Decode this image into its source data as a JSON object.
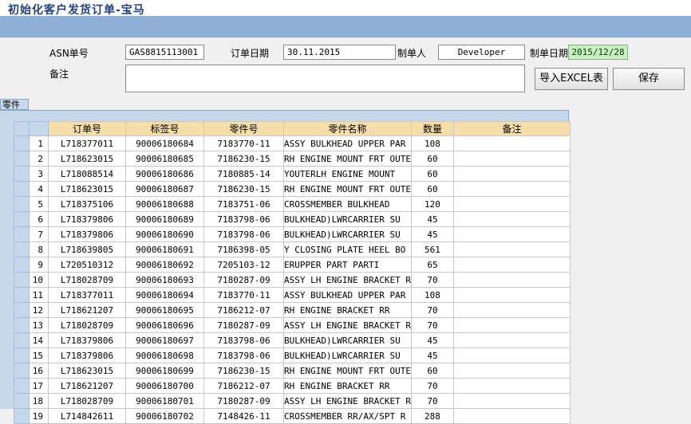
{
  "window": {
    "title": "初始化客户发货订单-宝马"
  },
  "form": {
    "asn_label": "ASN单号",
    "asn_value": "GAS8815113001",
    "order_date_label": "订单日期",
    "order_date_value": "30.11.2015",
    "creator_label": "制单人",
    "creator_value": "Developer",
    "create_date_label": "制单日期",
    "create_date_value": "2015/12/28",
    "remark_label": "备注",
    "remark_value": ""
  },
  "buttons": {
    "import_excel": "导入EXCEL表",
    "save": "保存"
  },
  "parts_tab": {
    "label": "零件"
  },
  "table": {
    "columns": [
      "订单号",
      "标签号",
      "零件号",
      "零件名称",
      "数量",
      "备注"
    ],
    "rows": [
      {
        "n": "1",
        "order": "L718377011",
        "tag": "90006180684",
        "part": "7183770-11",
        "name": "ASSY BULKHEAD UPPER PAR",
        "qty": "108",
        "remark": ""
      },
      {
        "n": "2",
        "order": "L718623015",
        "tag": "90006180685",
        "part": "7186230-15",
        "name": "RH ENGINE MOUNT FRT OUTE",
        "qty": "60",
        "remark": ""
      },
      {
        "n": "3",
        "order": "L718088514",
        "tag": "90006180686",
        "part": "7180885-14",
        "name": "YOUTERLH ENGINE MOUNT",
        "qty": "60",
        "remark": ""
      },
      {
        "n": "4",
        "order": "L718623015",
        "tag": "90006180687",
        "part": "7186230-15",
        "name": "RH ENGINE MOUNT FRT OUTE",
        "qty": "60",
        "remark": ""
      },
      {
        "n": "5",
        "order": "L718375106",
        "tag": "90006180688",
        "part": "7183751-06",
        "name": "CROSSMEMBER BULKHEAD",
        "qty": "120",
        "remark": ""
      },
      {
        "n": "6",
        "order": "L718379806",
        "tag": "90006180689",
        "part": "7183798-06",
        "name": "BULKHEAD)LWRCARRIER SU",
        "qty": "45",
        "remark": ""
      },
      {
        "n": "7",
        "order": "L718379806",
        "tag": "90006180690",
        "part": "7183798-06",
        "name": "BULKHEAD)LWRCARRIER SU",
        "qty": "45",
        "remark": ""
      },
      {
        "n": "8",
        "order": "L718639805",
        "tag": "90006180691",
        "part": "7186398-05",
        "name": "Y CLOSING PLATE HEEL BO",
        "qty": "561",
        "remark": ""
      },
      {
        "n": "9",
        "order": "L720510312",
        "tag": "90006180692",
        "part": "7205103-12",
        "name": "ERUPPER PART       PARTI",
        "qty": "65",
        "remark": ""
      },
      {
        "n": "10",
        "order": "L718028709",
        "tag": "90006180693",
        "part": "7180287-09",
        "name": "ASSY LH ENGINE BRACKET R",
        "qty": "70",
        "remark": ""
      },
      {
        "n": "11",
        "order": "L718377011",
        "tag": "90006180694",
        "part": "7183770-11",
        "name": "ASSY BULKHEAD UPPER PAR",
        "qty": "108",
        "remark": ""
      },
      {
        "n": "12",
        "order": "L718621207",
        "tag": "90006180695",
        "part": "7186212-07",
        "name": "RH ENGINE BRACKET RR",
        "qty": "70",
        "remark": ""
      },
      {
        "n": "13",
        "order": "L718028709",
        "tag": "90006180696",
        "part": "7180287-09",
        "name": "ASSY LH ENGINE BRACKET R",
        "qty": "70",
        "remark": ""
      },
      {
        "n": "14",
        "order": "L718379806",
        "tag": "90006180697",
        "part": "7183798-06",
        "name": "BULKHEAD)LWRCARRIER SU",
        "qty": "45",
        "remark": ""
      },
      {
        "n": "15",
        "order": "L718379806",
        "tag": "90006180698",
        "part": "7183798-06",
        "name": "BULKHEAD)LWRCARRIER SU",
        "qty": "45",
        "remark": ""
      },
      {
        "n": "16",
        "order": "L718623015",
        "tag": "90006180699",
        "part": "7186230-15",
        "name": "RH ENGINE MOUNT FRT OUTE",
        "qty": "60",
        "remark": ""
      },
      {
        "n": "17",
        "order": "L718621207",
        "tag": "90006180700",
        "part": "7186212-07",
        "name": "RH ENGINE BRACKET RR",
        "qty": "70",
        "remark": ""
      },
      {
        "n": "18",
        "order": "L718028709",
        "tag": "90006180701",
        "part": "7180287-09",
        "name": "ASSY LH ENGINE BRACKET R",
        "qty": "70",
        "remark": ""
      },
      {
        "n": "19",
        "order": "L714842611",
        "tag": "90006180702",
        "part": "7148426-11",
        "name": "CROSSMEMBER RR/AX/SPT R",
        "qty": "288",
        "remark": ""
      }
    ]
  }
}
